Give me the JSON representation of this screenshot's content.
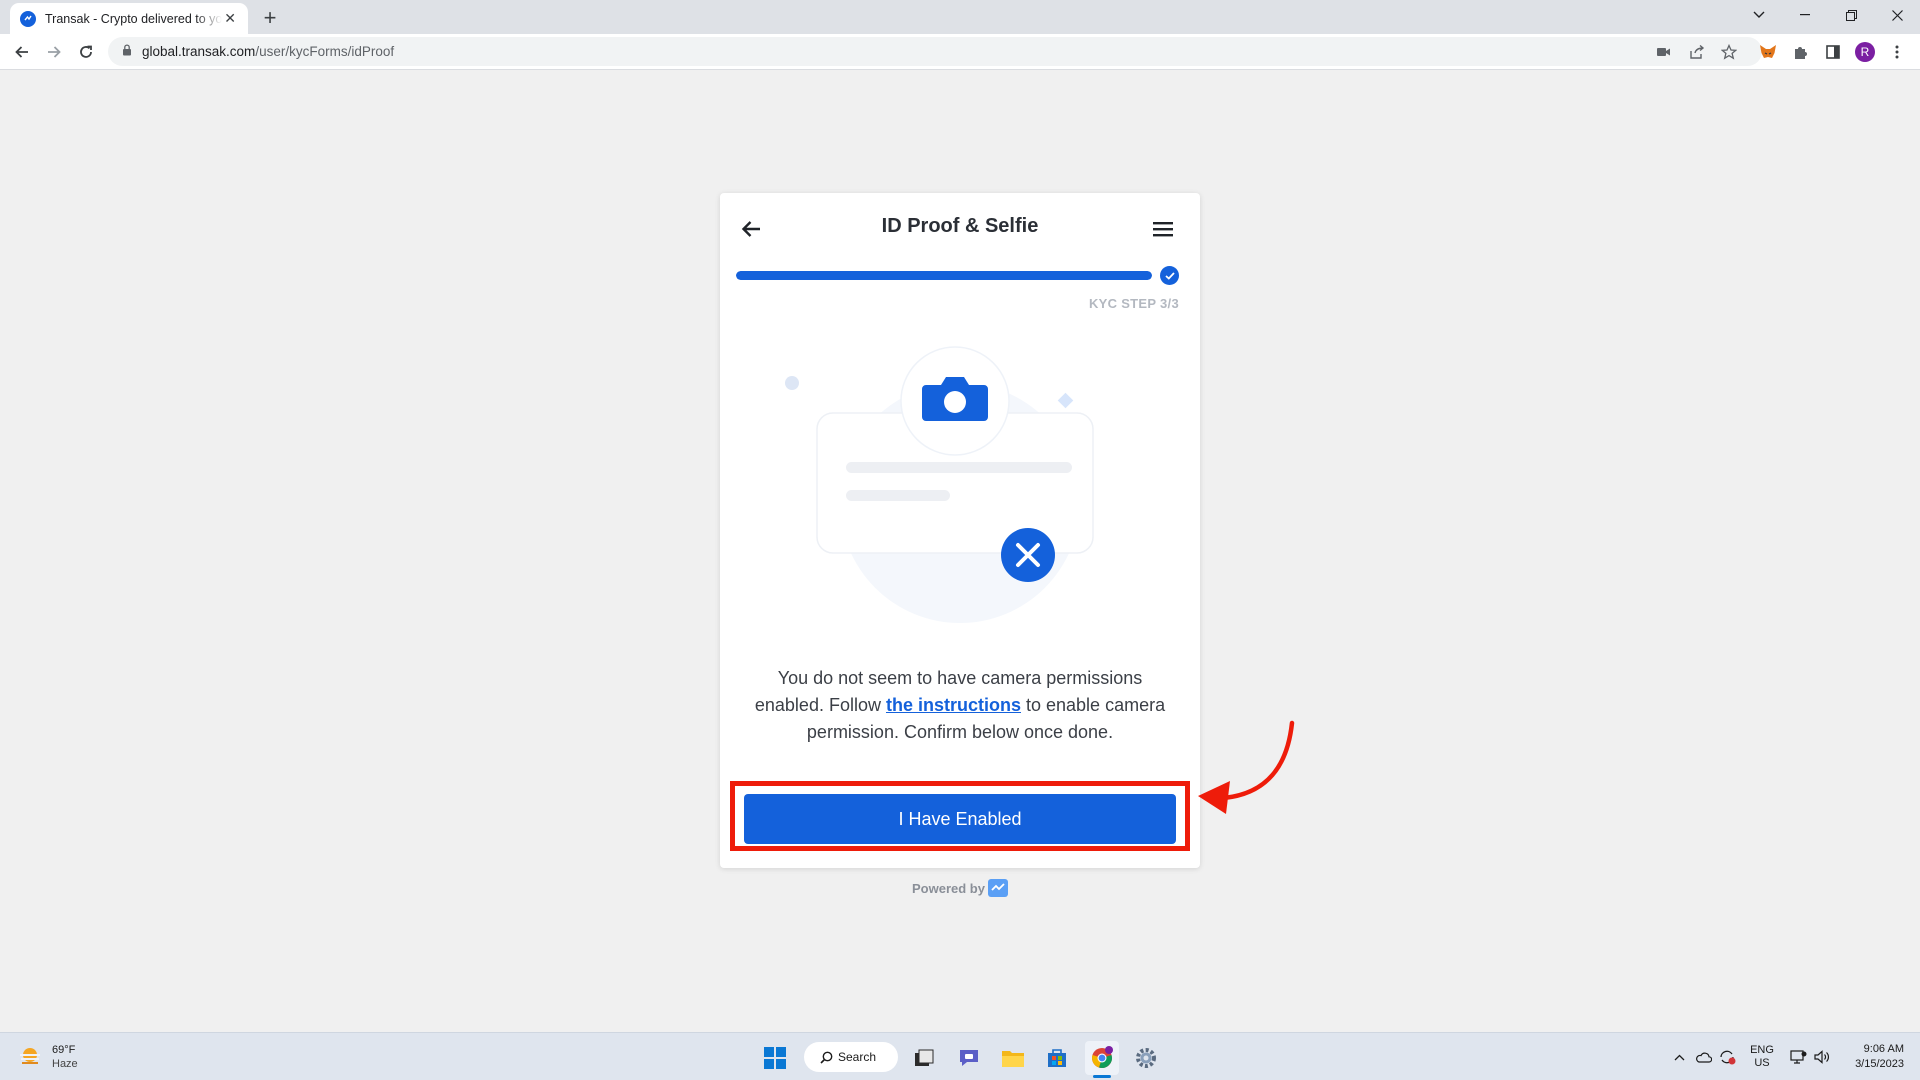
{
  "browser": {
    "tab_title": "Transak - Crypto delivered to you",
    "url_host": "global.transak.com",
    "url_path": "/user/kycForms/idProof",
    "profile_initial": "R"
  },
  "widget": {
    "title": "ID Proof & Selfie",
    "progress_fraction": 1.0,
    "step_label": "KYC STEP 3/3",
    "message_before": "You do not seem to have camera permissions enabled. Follow ",
    "message_link": "the instructions",
    "message_after": " to enable camera permission. Confirm below once done.",
    "button_label": "I Have Enabled",
    "powered_by": "Powered by"
  },
  "taskbar": {
    "weather_temp": "69°F",
    "weather_cond": "Haze",
    "search_label": "Search",
    "lang_top": "ENG",
    "lang_bottom": "US",
    "time": "9:06 AM",
    "date": "3/15/2023"
  },
  "colors": {
    "brand_blue": "#1461db",
    "highlight_red": "#ee1c0a"
  }
}
